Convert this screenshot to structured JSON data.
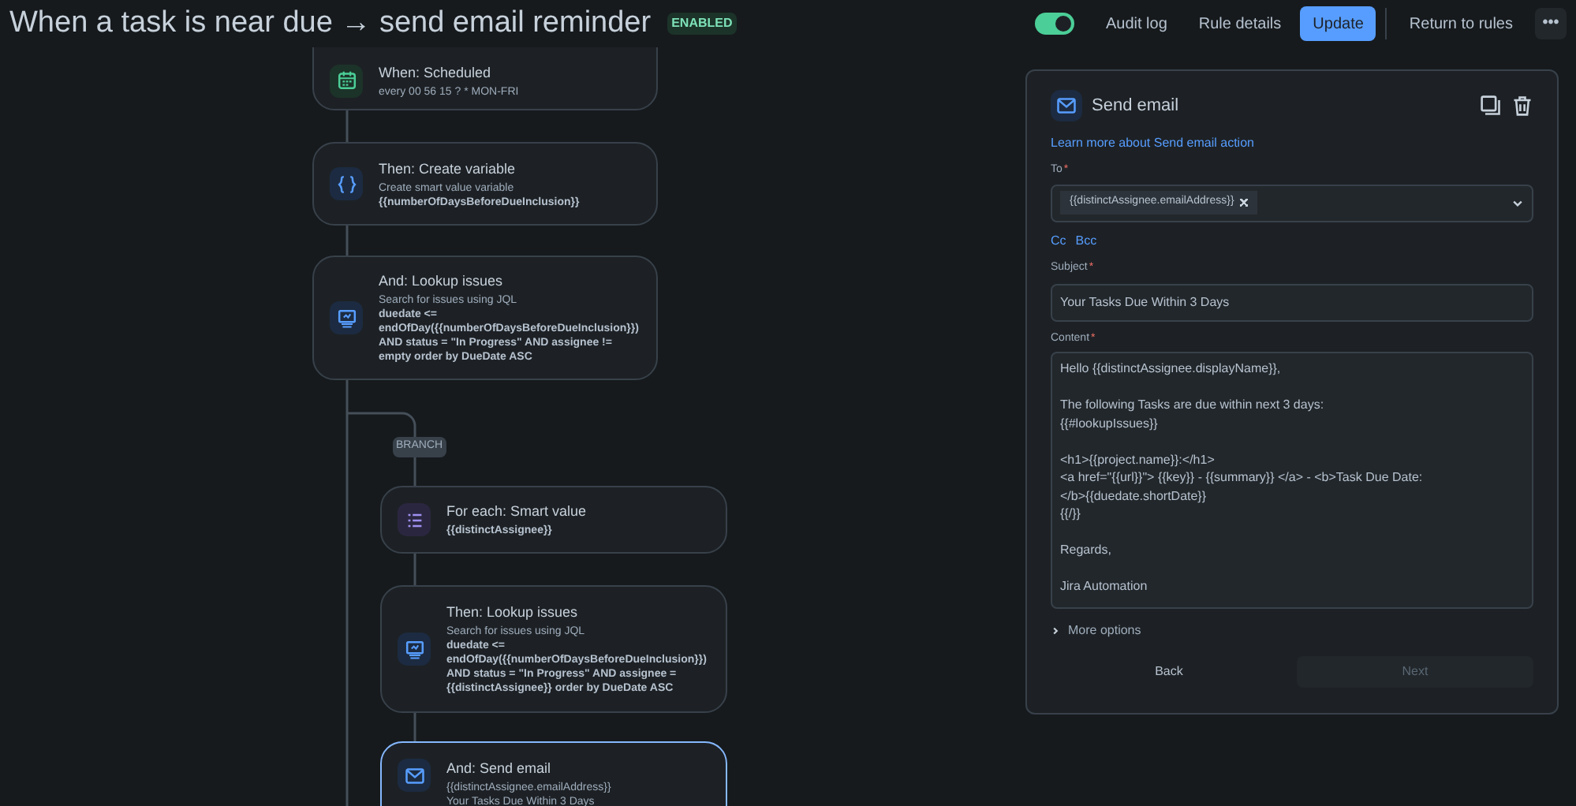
{
  "header": {
    "title": "When a task is near due → send email reminder",
    "status_badge": "ENABLED",
    "rule_enabled": {
      "on": true
    },
    "actions": [
      {
        "label": "Audit log",
        "kind": "plain"
      },
      {
        "label": "Rule details",
        "kind": "plain"
      },
      {
        "label": "Update",
        "kind": "primary"
      },
      {
        "label": "Return to rules",
        "kind": "plain"
      }
    ],
    "more_menu": "•••"
  },
  "flow": {
    "branch_label": "BRANCH",
    "nodes": [
      {
        "kind": "calendar",
        "title": "When: Scheduled",
        "description": "every 00 56 15 ? * MON-FRI",
        "selected": false
      },
      {
        "kind": "variable",
        "title": "Then: Create variable",
        "description": "Create smart value variable",
        "detail": "{{numberOfDaysBeforeDueInclusion}}",
        "selected": false
      },
      {
        "kind": "search",
        "title": "And: Lookup issues",
        "description": "Search for issues using JQL",
        "detail": "duedate <= endOfDay({{numberOfDaysBeforeDueInclusion}}) AND status = \"In Progress\" AND assignee != empty order by DueDate ASC",
        "selected": false
      },
      {
        "kind": "list",
        "title": "For each: Smart value",
        "detail": "{{distinctAssignee}}",
        "selected": false
      },
      {
        "kind": "search",
        "title": "Then: Lookup issues",
        "description": "Search for issues using JQL",
        "detail": "duedate <= endOfDay({{numberOfDaysBeforeDueInclusion}}) AND status = \"In Progress\" AND assignee = {{distinctAssignee}} order by DueDate ASC",
        "selected": false
      },
      {
        "kind": "email",
        "title": "And: Send email",
        "description": "{{distinctAssignee.emailAddress}}",
        "extra": "Your Tasks Due Within 3 Days",
        "selected": true
      }
    ]
  },
  "panel": {
    "title": "Send email",
    "learn_more_link": "Learn more about Send email action",
    "to": {
      "label": "To",
      "required_mark": "*",
      "chips": [
        "{{distinctAssignee.emailAddress}}"
      ]
    },
    "cc_links": [
      "Cc",
      "Bcc"
    ],
    "subject": {
      "label": "Subject",
      "required_mark": "*",
      "value": "Your Tasks Due Within 3 Days"
    },
    "content": {
      "label": "Content",
      "required_mark": "*",
      "value": "Hello {{distinctAssignee.displayName}},\n\nThe following Tasks are due within next 3 days:\n{{#lookupIssues}}\n\n<h1>{{project.name}}:</h1>\n<a href=\"{{url}}\"> {{key}} - {{summary}} </a> - <b>Task Due Date:\n</b>{{duedate.shortDate}}\n{{/}}\n\nRegards,\n\nJira Automation"
    },
    "more_options": {
      "label": "More options",
      "expanded": false
    },
    "buttons": [
      {
        "label": "Back",
        "disabled": false
      },
      {
        "label": "Next",
        "disabled": true
      }
    ]
  }
}
